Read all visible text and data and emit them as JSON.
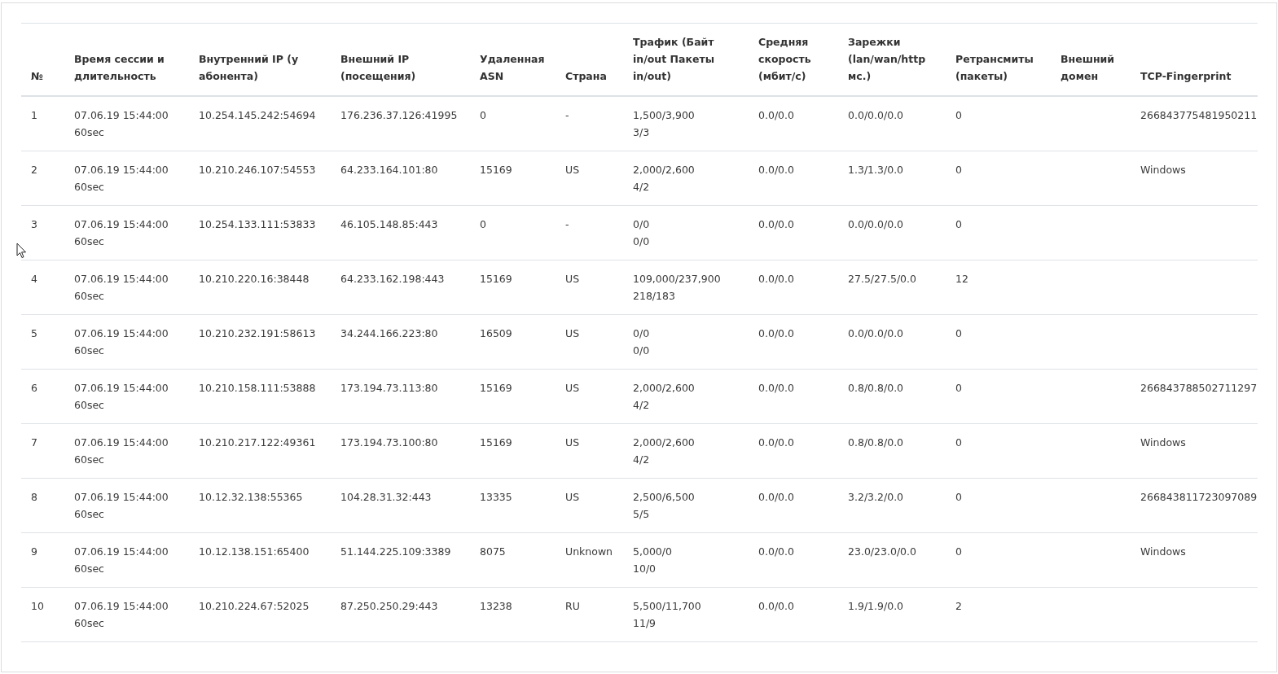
{
  "table": {
    "columns": [
      "№",
      "Время сессии и длительность",
      "Внутренний IP (у абонента)",
      "Внешний IP (посещения)",
      "Удаленная ASN",
      "Страна",
      "Трафик (Байт in/out Пакеты in/out)",
      "Средняя скорость (мбит/с)",
      "Зарежки (lan/wan/http мс.)",
      "Ретрансмиты (пакеты)",
      "Внешний домен",
      "TCP-Fingerprint"
    ],
    "rows": [
      {
        "no": "1",
        "session_time": "07.06.19 15:44:00",
        "duration": "60sec",
        "internal_ip": "10.254.145.242:54694",
        "external_ip": "176.236.37.126:41995",
        "asn": "0",
        "country": "-",
        "traffic_bytes": "1,500/3,900",
        "traffic_packets": "3/3",
        "avg_speed": "0.0/0.0",
        "delays": "0.0/0.0/0.0",
        "retransmits": "0",
        "tcp_fingerprint": "266843775481950211"
      },
      {
        "no": "2",
        "session_time": "07.06.19 15:44:00",
        "duration": "60sec",
        "internal_ip": "10.210.246.107:54553",
        "external_ip": "64.233.164.101:80",
        "asn": "15169",
        "country": "US",
        "traffic_bytes": "2,000/2,600",
        "traffic_packets": "4/2",
        "avg_speed": "0.0/0.0",
        "delays": "1.3/1.3/0.0",
        "retransmits": "0",
        "tcp_fingerprint": "Windows"
      },
      {
        "no": "3",
        "session_time": "07.06.19 15:44:00",
        "duration": "60sec",
        "internal_ip": "10.254.133.111:53833",
        "external_ip": "46.105.148.85:443",
        "asn": "0",
        "country": "-",
        "traffic_bytes": "0/0",
        "traffic_packets": "0/0",
        "avg_speed": "0.0/0.0",
        "delays": "0.0/0.0/0.0",
        "retransmits": "0"
      },
      {
        "no": "4",
        "session_time": "07.06.19 15:44:00",
        "duration": "60sec",
        "internal_ip": "10.210.220.16:38448",
        "external_ip": "64.233.162.198:443",
        "asn": "15169",
        "country": "US",
        "traffic_bytes": "109,000/237,900",
        "traffic_packets": "218/183",
        "avg_speed": "0.0/0.0",
        "delays": "27.5/27.5/0.0",
        "retransmits": "12"
      },
      {
        "no": "5",
        "session_time": "07.06.19 15:44:00",
        "duration": "60sec",
        "internal_ip": "10.210.232.191:58613",
        "external_ip": "34.244.166.223:80",
        "asn": "16509",
        "country": "US",
        "traffic_bytes": "0/0",
        "traffic_packets": "0/0",
        "avg_speed": "0.0/0.0",
        "delays": "0.0/0.0/0.0",
        "retransmits": "0"
      },
      {
        "no": "6",
        "session_time": "07.06.19 15:44:00",
        "duration": "60sec",
        "internal_ip": "10.210.158.111:53888",
        "external_ip": "173.194.73.113:80",
        "asn": "15169",
        "country": "US",
        "traffic_bytes": "2,000/2,600",
        "traffic_packets": "4/2",
        "avg_speed": "0.0/0.0",
        "delays": "0.8/0.8/0.0",
        "retransmits": "0",
        "tcp_fingerprint": "266843788502711297"
      },
      {
        "no": "7",
        "session_time": "07.06.19 15:44:00",
        "duration": "60sec",
        "internal_ip": "10.210.217.122:49361",
        "external_ip": "173.194.73.100:80",
        "asn": "15169",
        "country": "US",
        "traffic_bytes": "2,000/2,600",
        "traffic_packets": "4/2",
        "avg_speed": "0.0/0.0",
        "delays": "0.8/0.8/0.0",
        "retransmits": "0",
        "tcp_fingerprint": "Windows"
      },
      {
        "no": "8",
        "session_time": "07.06.19 15:44:00",
        "duration": "60sec",
        "internal_ip": "10.12.32.138:55365",
        "external_ip": "104.28.31.32:443",
        "asn": "13335",
        "country": "US",
        "traffic_bytes": "2,500/6,500",
        "traffic_packets": "5/5",
        "avg_speed": "0.0/0.0",
        "delays": "3.2/3.2/0.0",
        "retransmits": "0",
        "tcp_fingerprint": "266843811723097089"
      },
      {
        "no": "9",
        "session_time": "07.06.19 15:44:00",
        "duration": "60sec",
        "internal_ip": "10.12.138.151:65400",
        "external_ip": "51.144.225.109:3389",
        "asn": "8075",
        "country": "Unknown",
        "traffic_bytes": "5,000/0",
        "traffic_packets": "10/0",
        "avg_speed": "0.0/0.0",
        "delays": "23.0/23.0/0.0",
        "retransmits": "0",
        "tcp_fingerprint": "Windows"
      },
      {
        "no": "10",
        "session_time": "07.06.19 15:44:00",
        "duration": "60sec",
        "internal_ip": "10.210.224.67:52025",
        "external_ip": "87.250.250.29:443",
        "asn": "13238",
        "country": "RU",
        "traffic_bytes": "5,500/11,700",
        "traffic_packets": "11/9",
        "avg_speed": "0.0/0.0",
        "delays": "1.9/1.9/0.0",
        "retransmits": "2"
      }
    ]
  }
}
